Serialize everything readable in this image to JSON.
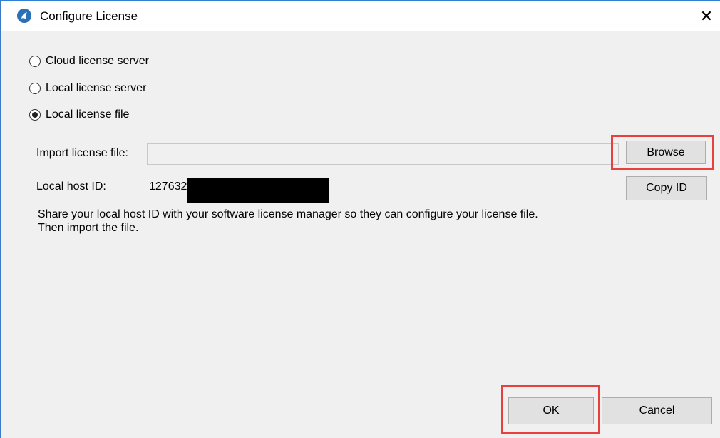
{
  "window": {
    "title": "Configure License",
    "close_glyph": "✕",
    "icon": "app-logo-icon"
  },
  "license_options": [
    {
      "label": "Cloud license server",
      "checked": false
    },
    {
      "label": "Local license server",
      "checked": false
    },
    {
      "label": "Local license file",
      "checked": true
    }
  ],
  "import": {
    "label": "Import license file:",
    "value": "",
    "browse_label": "Browse"
  },
  "host": {
    "label": "Local host ID:",
    "value_visible": "127632",
    "copy_label": "Copy ID"
  },
  "message": {
    "line1": "Share your local host ID with your software license manager so they can configure your license file.",
    "line2": "Then import the file."
  },
  "footer": {
    "ok_label": "OK",
    "cancel_label": "Cancel"
  },
  "colors": {
    "highlight": "#e8403f",
    "accent": "#2f7fd6",
    "dialog_bg": "#f0f0f0"
  }
}
